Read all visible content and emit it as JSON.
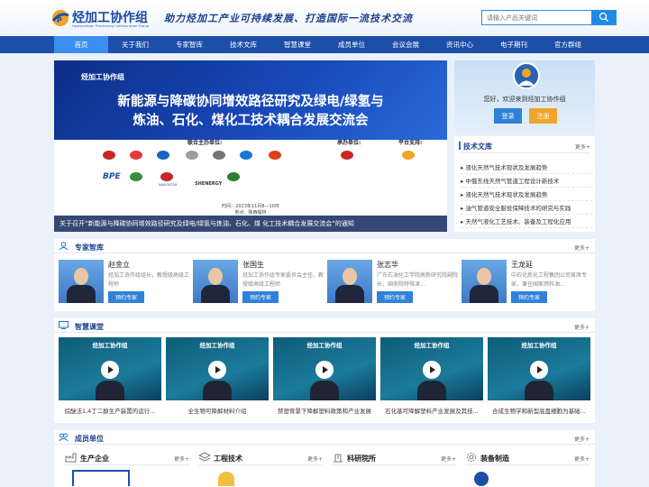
{
  "header": {
    "logo_cn": "烃加工协作组",
    "logo_en": "Hydrocarbon Processing Collaboration Group",
    "slogan": "助力烃加工产业可持续发展、打造国际一流技术交流",
    "search_placeholder": "请输入产品关键词",
    "colors": {
      "brand": "#1b4fa8",
      "accent": "#3a8ff0"
    }
  },
  "nav": {
    "items": [
      "首页",
      "关于我们",
      "专家智库",
      "技术文库",
      "智慧课堂",
      "成员单位",
      "会议会展",
      "资讯中心",
      "电子期刊",
      "官方群组"
    ],
    "active_index": 0
  },
  "banner": {
    "logo": "烃加工协作组",
    "title_line1": "新能源与降碳协同增效路径研究及绿电/绿氢与",
    "title_line2": "炼油、石化、煤化工技术耦合发展交流会",
    "joint_label": "联合主办单位:",
    "host_label": "承办单位:",
    "platform_label": "平台支持:",
    "date": "时间：2023年11月8—10日",
    "place": "地点：陕西榆林",
    "caption": "关于召开“新能源与降碳协同增效路径研究及绿电/绿氢与炼油、石化、煤 化工技术耦合发展交流会”的通知",
    "org_logos": [
      "BPE",
      "NAVIGATOR",
      "SHENERGY"
    ]
  },
  "login": {
    "welcome": "您好，欢迎来到烃加工协作组",
    "login_label": "登录",
    "register_label": "注册"
  },
  "tech_library": {
    "title": "技术文库",
    "more": "更多+",
    "items": [
      "液化天然气技术现状及发展趋势",
      "中俄东线天然气管道工程设计新技术",
      "液化天然气技术现状及发展趋势",
      "油气管道安全服役保障技术的研究与实践",
      "天然气液化工艺技术、装备及工程化应用"
    ]
  },
  "experts": {
    "title": "专家智库",
    "more": "更多+",
    "button_label": "预约专家",
    "list": [
      {
        "name": "赵金立",
        "desc": "烃加工协作组组长，教授级高级工程师"
      },
      {
        "name": "张国生",
        "desc": "烃加工协作组专家委员会主任、教授级高级工程师"
      },
      {
        "name": "张志华",
        "desc": "广东石油化工学院高新研究院副院长，国务院特殊津..."
      },
      {
        "name": "王龙延",
        "desc": "中石化炼化工程集团公司首席专家，兼任国家燃料油..."
      }
    ]
  },
  "courses": {
    "title": "智慧课堂",
    "more": "更多+",
    "thumb_logo": "烃加工协作组",
    "list": [
      "烷醚法1,4丁二醇生产装置的运行...",
      "全生物可降解材料介绍",
      "禁塑背景下降解塑料政策和产业发展",
      "石化基可降解塑料产业发展及其技...",
      "合成生物学和新型底盘细胞为基础..."
    ]
  },
  "members": {
    "title": "成员单位",
    "more": "更多+",
    "columns": [
      {
        "title": "生产企业",
        "more": "更多+"
      },
      {
        "title": "工程技术",
        "more": "更多+"
      },
      {
        "title": "科研院所",
        "more": "更多+"
      },
      {
        "title": "装备制造",
        "more": "更多+"
      }
    ]
  }
}
